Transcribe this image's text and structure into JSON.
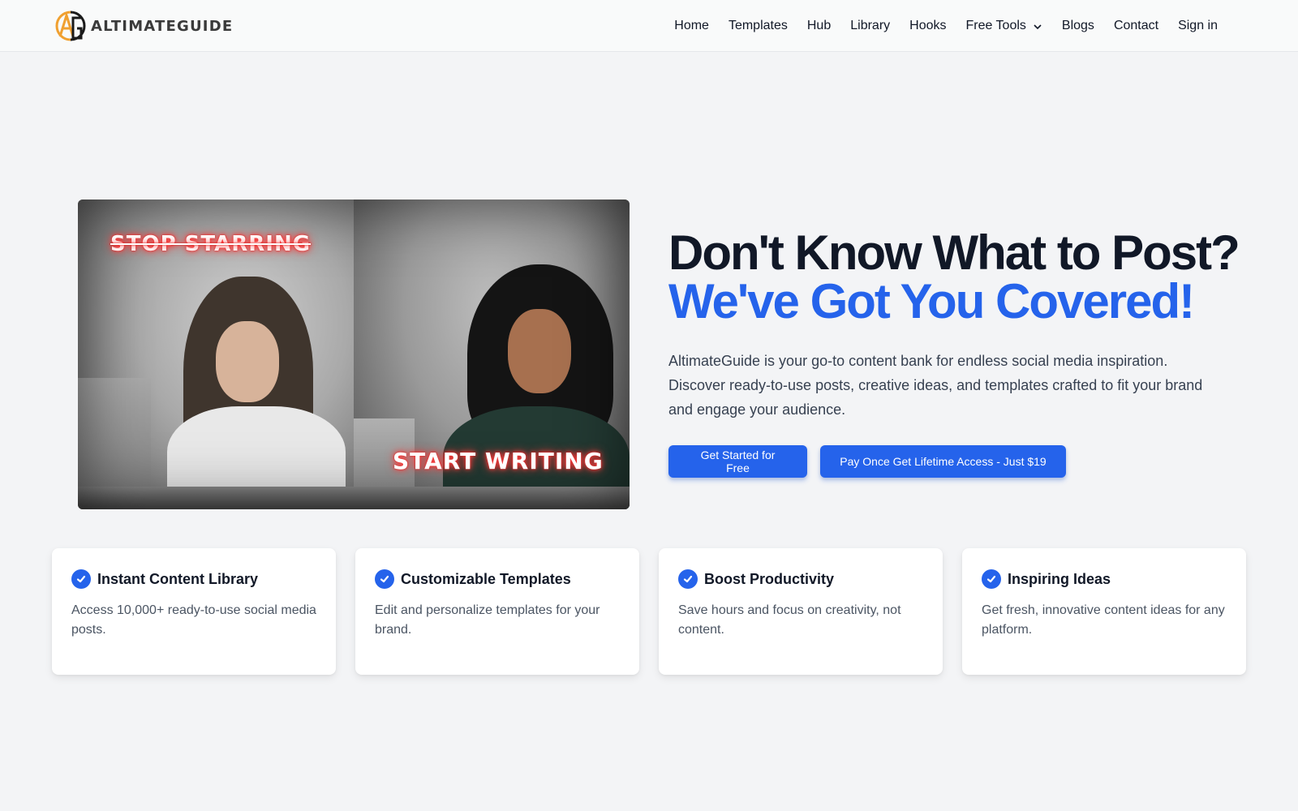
{
  "header": {
    "logo_text": "ALTIMATEGUIDE",
    "logo_colors": {
      "a": "#f0a030",
      "g": "#1a1a1a"
    },
    "nav": [
      {
        "label": "Home"
      },
      {
        "label": "Templates"
      },
      {
        "label": "Hub"
      },
      {
        "label": "Library"
      },
      {
        "label": "Hooks"
      },
      {
        "label": "Free Tools",
        "icon": "chevron-down-icon"
      },
      {
        "label": "Blogs"
      },
      {
        "label": "Contact"
      },
      {
        "label": "Sign in"
      }
    ]
  },
  "hero": {
    "image": {
      "overlay_top": "STOP STARRING",
      "overlay_bottom": "START WRITING"
    },
    "headline_line1": "Don't Know What to Post?",
    "headline_line2": "We've Got You Covered!",
    "description": "AltimateGuide is your go-to content bank for endless social media inspiration. Discover ready-to-use posts, creative ideas, and templates crafted to fit your brand and engage your audience.",
    "buttons": {
      "primary": "Get Started for Free",
      "secondary": "Pay Once Get Lifetime Access - Just $19"
    },
    "accent_color": "#2563eb"
  },
  "features": [
    {
      "icon": "check-circle-icon",
      "title": "Instant Content Library",
      "description": "Access 10,000+ ready-to-use social media posts."
    },
    {
      "icon": "check-circle-icon",
      "title": "Customizable Templates",
      "description": "Edit and personalize templates for your brand."
    },
    {
      "icon": "check-circle-icon",
      "title": "Boost Productivity",
      "description": "Save hours and focus on creativity, not content."
    },
    {
      "icon": "check-circle-icon",
      "title": "Inspiring Ideas",
      "description": "Get fresh, innovative content ideas for any platform."
    }
  ]
}
